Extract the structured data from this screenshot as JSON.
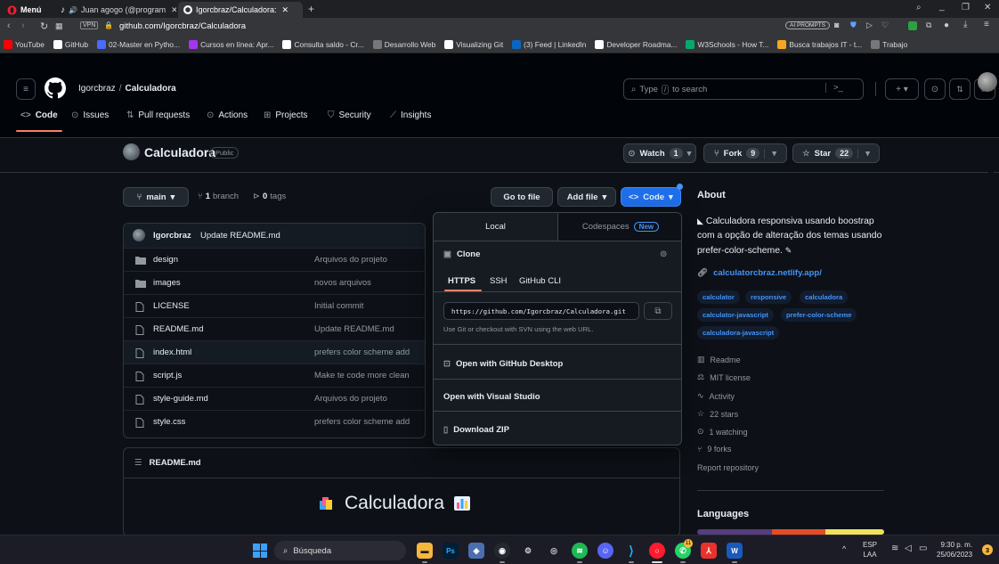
{
  "browser": {
    "menu_label": "Menú",
    "tabs": [
      {
        "label": "Juan agogo (@program"
      },
      {
        "label": "Igorcbraz/Calculadora: "
      }
    ],
    "url_badge": "VPN",
    "url": "github.com/Igorcbraz/Calculadora",
    "ai_prompts": "AI PROMPTS",
    "bookmarks": [
      {
        "label": "YouTube",
        "color": "#ff0000"
      },
      {
        "label": "GitHub",
        "color": "#ffffff"
      },
      {
        "label": "02-Master en Pytho...",
        "color": "#4a6cf7"
      },
      {
        "label": "Cursos en línea: Apr...",
        "color": "#a435f0"
      },
      {
        "label": "Consulta saldo - Cr...",
        "color": "#ffffff"
      },
      {
        "label": "Desarrollo Web",
        "color": "#777777"
      },
      {
        "label": "Visualizing Git",
        "color": "#ffffff"
      },
      {
        "label": "(3) Feed | LinkedIn",
        "color": "#0a66c2"
      },
      {
        "label": "Developer Roadma...",
        "color": "#ffffff"
      },
      {
        "label": "W3Schools - How T...",
        "color": "#04aa6d"
      },
      {
        "label": "Busca trabajos IT - t...",
        "color": "#f5a623"
      },
      {
        "label": "Trabajo",
        "color": "#777777"
      }
    ]
  },
  "github": {
    "owner": "Igorcbraz",
    "separator": "/",
    "repo": "Calculadora",
    "search_placeholder_pre": "Type",
    "search_key": "/",
    "search_placeholder_post": "to search",
    "nav": [
      {
        "label": "Code"
      },
      {
        "label": "Issues"
      },
      {
        "label": "Pull requests"
      },
      {
        "label": "Actions"
      },
      {
        "label": "Projects"
      },
      {
        "label": "Security"
      },
      {
        "label": "Insights"
      }
    ]
  },
  "repo": {
    "name": "Calculadora",
    "visibility": "Public",
    "watch_label": "Watch",
    "watch_count": "1",
    "fork_label": "Fork",
    "fork_count": "9",
    "star_label": "Star",
    "star_count": "22",
    "branch": "main",
    "branches_count": "1",
    "branches_label": "branch",
    "tags_count": "0",
    "tags_label": "tags",
    "go_to_file": "Go to file",
    "add_file": "Add file",
    "code_button": "Code",
    "last_commit_author": "Igorcbraz",
    "last_commit_msg": "Update README.md",
    "files": [
      {
        "name": "design",
        "msg": "Arquivos do projeto",
        "type": "folder"
      },
      {
        "name": "images",
        "msg": "novos arquivos",
        "type": "folder"
      },
      {
        "name": "LICENSE",
        "msg": "Initial commit",
        "type": "file"
      },
      {
        "name": "README.md",
        "msg": "Update README.md",
        "type": "file"
      },
      {
        "name": "index.html",
        "msg": "prefers color scheme add",
        "type": "file"
      },
      {
        "name": "script.js",
        "msg": "Make te code more clean",
        "type": "file"
      },
      {
        "name": "style-guide.md",
        "msg": "Arquivos do projeto",
        "type": "file"
      },
      {
        "name": "style.css",
        "msg": "prefers color scheme add",
        "type": "file"
      }
    ],
    "readme_label": "README.md",
    "readme_title": "Calculadora"
  },
  "clone": {
    "tab_local": "Local",
    "tab_codespaces": "Codespaces",
    "new_badge": "New",
    "clone_title": "Clone",
    "protocols": [
      "HTTPS",
      "SSH",
      "GitHub CLI"
    ],
    "url": "https://github.com/Igorcbraz/Calculadora.git",
    "hint": "Use Git or checkout with SVN using the web URL.",
    "open_desktop": "Open with GitHub Desktop",
    "open_vs": "Open with Visual Studio",
    "download_zip": "Download ZIP"
  },
  "about": {
    "title": "About",
    "description": "Calculadora responsiva usando boostrap com a opção de alteração dos temas usando prefer-color-scheme.",
    "website": "calculatorcbraz.netlify.app/",
    "topics": [
      "calculator",
      "responsive",
      "calculadora",
      "calculator-javascript",
      "prefer-color-scheme",
      "calculadora-javascript"
    ],
    "readme": "Readme",
    "license": "MIT license",
    "activity": "Activity",
    "stars": "22 stars",
    "watching": "1 watching",
    "forks": "9 forks",
    "report": "Report repository",
    "languages": "Languages"
  },
  "taskbar": {
    "search": "Búsqueda",
    "lang_top": "ESP",
    "lang_bottom": "LAA",
    "time": "9:30 p. m.",
    "date": "25/06/2023",
    "notif_count": "3",
    "opera_badge": "11"
  }
}
